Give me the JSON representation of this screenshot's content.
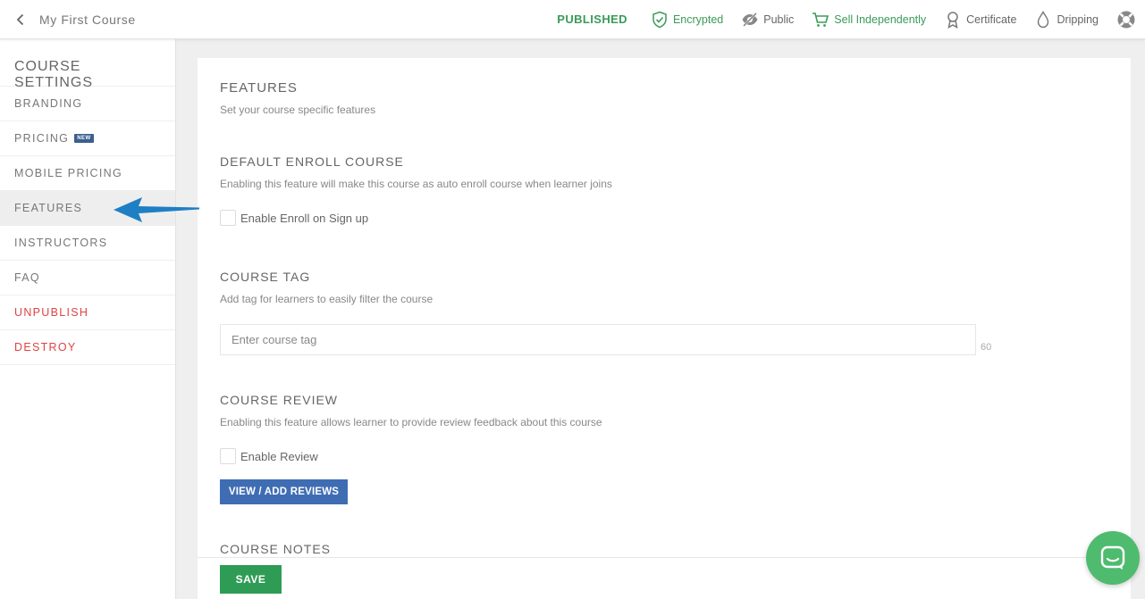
{
  "header": {
    "course_title": "My First Course",
    "status": "PUBLISHED",
    "items": [
      {
        "label": "Encrypted",
        "icon": "shield-check-icon",
        "color": "#3a9b59"
      },
      {
        "label": "Public",
        "icon": "eye-slash-icon"
      },
      {
        "label": "Sell Independently",
        "icon": "cart-icon",
        "color": "#3a9b59"
      },
      {
        "label": "Certificate",
        "icon": "ribbon-icon"
      },
      {
        "label": "Dripping",
        "icon": "drop-icon"
      }
    ],
    "help_icon": "lifebuoy-icon"
  },
  "sidebar": {
    "title": "COURSE SETTINGS",
    "items": [
      {
        "label": "BRANDING"
      },
      {
        "label": "PRICING",
        "badge": "NEW"
      },
      {
        "label": "MOBILE PRICING"
      },
      {
        "label": "FEATURES",
        "active": true
      },
      {
        "label": "INSTRUCTORS"
      },
      {
        "label": "FAQ"
      },
      {
        "label": "UNPUBLISH",
        "color": "#e14242"
      },
      {
        "label": "DESTROY",
        "color": "#e14242"
      }
    ]
  },
  "main": {
    "title": "FEATURES",
    "subtitle": "Set your course specific features",
    "enroll": {
      "heading": "DEFAULT ENROLL COURSE",
      "description": "Enabling this feature will make this course as auto enroll course when learner joins",
      "checkbox_label": "Enable Enroll on Sign up"
    },
    "tag": {
      "heading": "COURSE TAG",
      "description": "Add tag for learners to easily filter the course",
      "placeholder": "Enter course tag",
      "counter": "60"
    },
    "review": {
      "heading": "COURSE REVIEW",
      "description": "Enabling this feature allows learner to provide review feedback about this course",
      "checkbox_label": "Enable Review",
      "button_label": "VIEW / ADD REVIEWS"
    },
    "notes": {
      "heading": "COURSE NOTES"
    }
  },
  "footer": {
    "save_label": "SAVE"
  },
  "colors": {
    "accent_green": "#2f9c55",
    "button_blue": "#3f6db3",
    "danger_red": "#e14242",
    "chat_green": "#4fbb6f"
  }
}
